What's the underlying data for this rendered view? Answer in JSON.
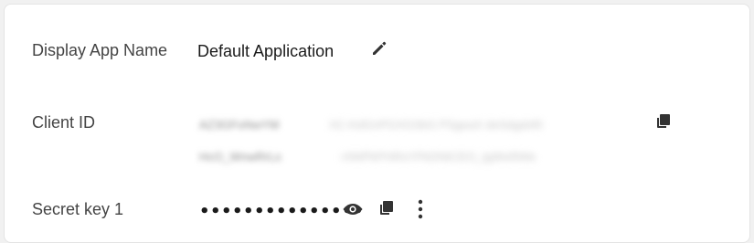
{
  "rows": {
    "display_name": {
      "label": "Display App Name",
      "value": "Default Application",
      "edit_icon": "pencil-icon"
    },
    "client_id": {
      "label": "Client ID",
      "value_line1_start": "AZ3GFoNwYM",
      "value_line1_end": "hC-KdGnPGXGSkS PSgeaX deSdgdsf0",
      "value_line2_start": "HcO_WnwRrLs",
      "value_line2_end": "-HWPkPHRsYPkDNtCEO_tgWoRWe",
      "copy_icon": "copy-icon"
    },
    "secret_key": {
      "label": "Secret key 1",
      "masked_value": "•••••••••••••••",
      "reveal_icon": "eye-icon",
      "copy_icon": "copy-icon",
      "menu_icon": "more-vertical-icon"
    }
  },
  "colors": {
    "label_text": "#444444",
    "value_text": "#1a1a1a",
    "icon": "#333333",
    "card_background": "#ffffff",
    "page_background": "#f1f1f1"
  }
}
